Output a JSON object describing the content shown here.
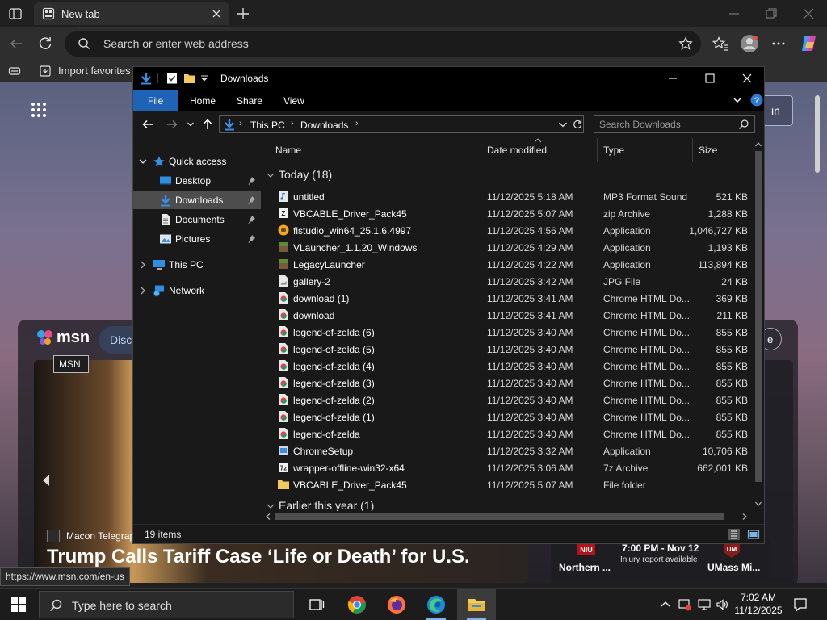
{
  "browser": {
    "tab_title": "New tab",
    "address_placeholder": "Search or enter web address",
    "fav_import": "Import favorites",
    "status_url": "https://www.msn.com/en-us"
  },
  "msn": {
    "logo": "msn",
    "tooltip": "MSN",
    "discover_label": "Disco",
    "signin_label": "in",
    "side_btn": "e",
    "news_source": "Macon Telegraph",
    "headline": "Trump Calls Tariff Case ‘Life or Death’ for U.S.",
    "game": {
      "time": "7:00 PM - Nov 12",
      "note": "Injury report available",
      "team_left": "Northern ...",
      "team_right": "UMass Mi..."
    }
  },
  "explorer": {
    "title": "Downloads",
    "ribbon_tabs": [
      "File",
      "Home",
      "Share",
      "View"
    ],
    "breadcrumb": [
      "This PC",
      "Downloads"
    ],
    "search_placeholder": "Search Downloads",
    "nav": {
      "quick_access": "Quick access",
      "desktop": "Desktop",
      "downloads": "Downloads",
      "documents": "Documents",
      "pictures": "Pictures",
      "this_pc": "This PC",
      "network": "Network"
    },
    "columns": {
      "name": "Name",
      "date": "Date modified",
      "type": "Type",
      "size": "Size"
    },
    "group_today": "Today (18)",
    "group_earlier": "Earlier this year (1)",
    "files": [
      {
        "name": "untitled",
        "date": "11/12/2025 5:18 AM",
        "type": "MP3 Format Sound",
        "size": "521 KB",
        "icon": "audio-file-icon"
      },
      {
        "name": "VBCABLE_Driver_Pack45",
        "date": "11/12/2025 5:07 AM",
        "type": "zip Archive",
        "size": "1,288 KB",
        "icon": "zip-archive-icon"
      },
      {
        "name": "flstudio_win64_25.1.6.4997",
        "date": "11/12/2025 4:56 AM",
        "type": "Application",
        "size": "1,046,727 KB",
        "icon": "flstudio-app-icon"
      },
      {
        "name": "VLauncher_1.1.20_Windows",
        "date": "11/12/2025 4:29 AM",
        "type": "Application",
        "size": "1,193 KB",
        "icon": "minecraft-block-icon"
      },
      {
        "name": "LegacyLauncher",
        "date": "11/12/2025 4:22 AM",
        "type": "Application",
        "size": "113,894 KB",
        "icon": "minecraft-block-icon"
      },
      {
        "name": "gallery-2",
        "date": "11/12/2025 3:42 AM",
        "type": "JPG File",
        "size": "24 KB",
        "icon": "image-file-icon"
      },
      {
        "name": "download (1)",
        "date": "11/12/2025 3:41 AM",
        "type": "Chrome HTML Do...",
        "size": "369 KB",
        "icon": "chrome-html-icon"
      },
      {
        "name": "download",
        "date": "11/12/2025 3:41 AM",
        "type": "Chrome HTML Do...",
        "size": "211 KB",
        "icon": "chrome-html-icon"
      },
      {
        "name": "legend-of-zelda (6)",
        "date": "11/12/2025 3:40 AM",
        "type": "Chrome HTML Do...",
        "size": "855 KB",
        "icon": "chrome-html-icon"
      },
      {
        "name": "legend-of-zelda (5)",
        "date": "11/12/2025 3:40 AM",
        "type": "Chrome HTML Do...",
        "size": "855 KB",
        "icon": "chrome-html-icon"
      },
      {
        "name": "legend-of-zelda (4)",
        "date": "11/12/2025 3:40 AM",
        "type": "Chrome HTML Do...",
        "size": "855 KB",
        "icon": "chrome-html-icon"
      },
      {
        "name": "legend-of-zelda (3)",
        "date": "11/12/2025 3:40 AM",
        "type": "Chrome HTML Do...",
        "size": "855 KB",
        "icon": "chrome-html-icon"
      },
      {
        "name": "legend-of-zelda (2)",
        "date": "11/12/2025 3:40 AM",
        "type": "Chrome HTML Do...",
        "size": "855 KB",
        "icon": "chrome-html-icon"
      },
      {
        "name": "legend-of-zelda (1)",
        "date": "11/12/2025 3:40 AM",
        "type": "Chrome HTML Do...",
        "size": "855 KB",
        "icon": "chrome-html-icon"
      },
      {
        "name": "legend-of-zelda",
        "date": "11/12/2025 3:40 AM",
        "type": "Chrome HTML Do...",
        "size": "855 KB",
        "icon": "chrome-html-icon"
      },
      {
        "name": "ChromeSetup",
        "date": "11/12/2025 3:32 AM",
        "type": "Application",
        "size": "10,706 KB",
        "icon": "installer-icon"
      },
      {
        "name": "wrapper-offline-win32-x64",
        "date": "11/12/2025 3:06 AM",
        "type": "7z Archive",
        "size": "662,001 KB",
        "icon": "7z-archive-icon"
      },
      {
        "name": "VBCABLE_Driver_Pack45",
        "date": "11/12/2025 5:07 AM",
        "type": "File folder",
        "size": "",
        "icon": "folder-icon"
      }
    ],
    "status_count": "19 items"
  },
  "taskbar": {
    "search_placeholder": "Type here to search",
    "time": "7:02 AM",
    "date": "11/12/2025"
  },
  "colors": {
    "accent": "#1e63b5",
    "selected_nav": "#4d4d4d",
    "explorer_bg": "#191919",
    "taskbar_bg": "#1c1c1c"
  }
}
